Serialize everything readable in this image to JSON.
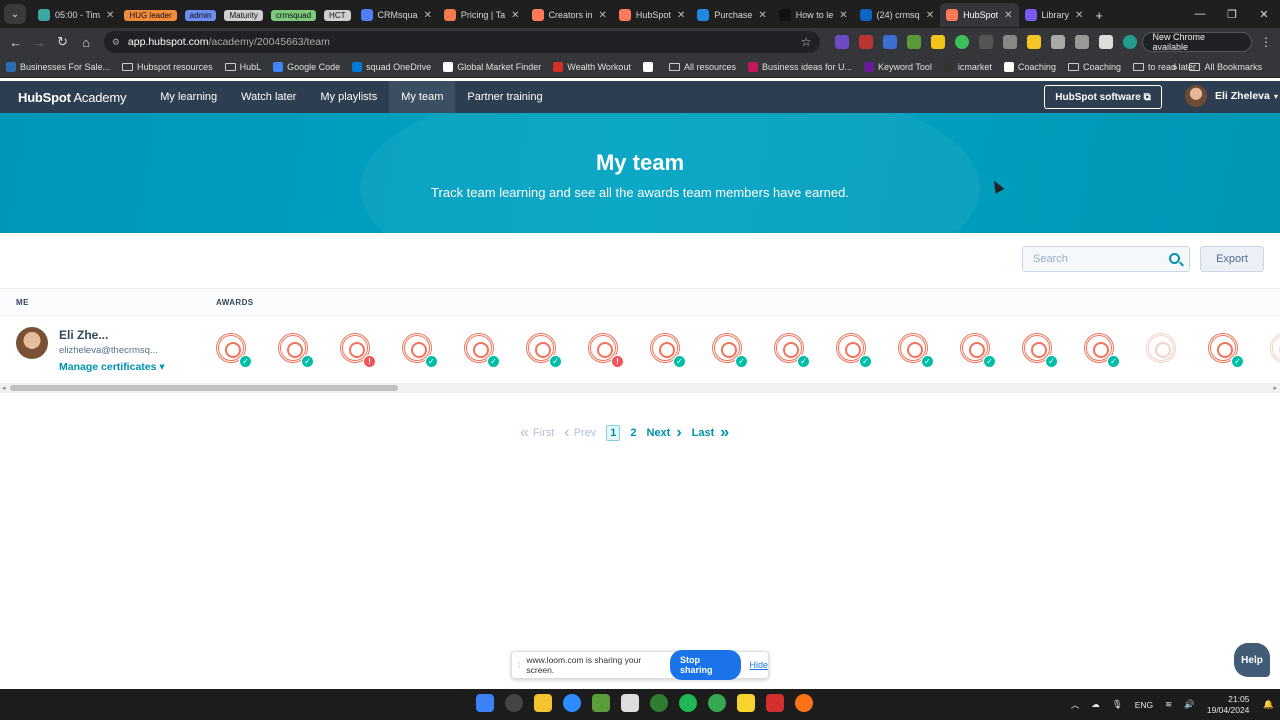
{
  "browser": {
    "tabs": [
      {
        "label": "05:00 - Tim",
        "color": "#3aa7a0",
        "pill": false
      },
      {
        "label": "HUG leader",
        "color": "#f28b3c",
        "pill": true
      },
      {
        "label": "admin",
        "color": "#6d8ef0",
        "pill": true
      },
      {
        "label": "Maturity",
        "color": "#cfcfcf",
        "pill": true
      },
      {
        "label": "crmsquad",
        "color": "#7dc97d",
        "pill": true
      },
      {
        "label": "HCT",
        "color": "#cfcfcf",
        "pill": true
      },
      {
        "label": "CRMsqua",
        "color": "#4f7ef5",
        "pill": false
      },
      {
        "label": "Pricing | Ta",
        "color": "#f07a4a",
        "pill": false
      },
      {
        "label": "Creators in",
        "color": "#ff7a59",
        "pill": false
      },
      {
        "label": "HubSpot",
        "color": "#ff7a59",
        "pill": false
      },
      {
        "label": "Purchase",
        "color": "#1e88e5",
        "pill": false
      },
      {
        "label": "How to le",
        "color": "#111111",
        "pill": false
      },
      {
        "label": "(24) crmsq",
        "color": "#0a66c2",
        "pill": false
      },
      {
        "label": "HubSpot",
        "color": "#ff7a59",
        "pill": false,
        "active": true
      },
      {
        "label": "Library",
        "color": "#7a5af5",
        "pill": false
      }
    ],
    "url_host": "app.hubspot.com",
    "url_path": "/academy/20045663/team",
    "new_chrome_label": "New Chrome available",
    "bookmarks": [
      {
        "label": "Businesses For Sale...",
        "icon": "#2b6cb0"
      },
      {
        "label": "Hubspot resources",
        "icon": "folder"
      },
      {
        "label": "HubL",
        "icon": "folder"
      },
      {
        "label": "Google Code",
        "icon": "#4285f4"
      },
      {
        "label": "squad OneDrive",
        "icon": "#0078d4"
      },
      {
        "label": "Global Market Finder",
        "icon": "#ffffff"
      },
      {
        "label": "Wealth Workout",
        "icon": "#d93025"
      },
      {
        "label": "",
        "icon": "#ffffff"
      },
      {
        "label": "All resources",
        "icon": "folder"
      },
      {
        "label": "Business ideas for U...",
        "icon": "#c2185b"
      },
      {
        "label": "Keyword Tool",
        "icon": "#6a1b9a"
      },
      {
        "label": "icmarket",
        "icon": "#333333"
      },
      {
        "label": "Coaching",
        "icon": "#ffffff"
      },
      {
        "label": "Coaching",
        "icon": "folder"
      },
      {
        "label": "to read later",
        "icon": "folder"
      }
    ],
    "all_bookmarks": "All Bookmarks"
  },
  "hubspot_nav": {
    "logo_bold": "HubSpot",
    "logo_light": " Academy",
    "items": [
      "My learning",
      "Watch later",
      "My playlists",
      "My team",
      "Partner training"
    ],
    "active_index": 3,
    "software_button": "HubSpot software ⧉",
    "user_name": "Eli Zheleva"
  },
  "banner": {
    "title": "My team",
    "subtitle": "Track team learning and see all the awards team members have earned."
  },
  "toolbar": {
    "search_placeholder": "Search",
    "export_label": "Export"
  },
  "table": {
    "col_me": "ME",
    "col_awards": "AWARDS",
    "member": {
      "name": "Eli Zhe...",
      "email": "elizheleva@thecrmsq...",
      "manage_label": "Manage certificates ▾"
    },
    "badges": [
      {
        "status": "ok"
      },
      {
        "status": "ok"
      },
      {
        "status": "warn"
      },
      {
        "status": "ok"
      },
      {
        "status": "ok"
      },
      {
        "status": "ok"
      },
      {
        "status": "warn"
      },
      {
        "status": "ok"
      },
      {
        "status": "ok"
      },
      {
        "status": "ok"
      },
      {
        "status": "ok"
      },
      {
        "status": "ok"
      },
      {
        "status": "ok"
      },
      {
        "status": "ok"
      },
      {
        "status": "ok"
      },
      {
        "status": "none"
      },
      {
        "status": "ok"
      },
      {
        "status": "none"
      }
    ],
    "warn_symbol": "!",
    "ok_symbol": "✓"
  },
  "pagination": {
    "first": "First",
    "prev": "Prev",
    "pages": [
      "1",
      "2"
    ],
    "current": "1",
    "next": "Next",
    "last": "Last"
  },
  "share_bar": {
    "text": "www.loom.com is sharing your screen.",
    "stop_label": "Stop sharing",
    "hide_label": "Hide"
  },
  "help_label": "Help",
  "taskbar": {
    "lang": "ENG",
    "time": "21:05",
    "date": "19/04/2024"
  }
}
